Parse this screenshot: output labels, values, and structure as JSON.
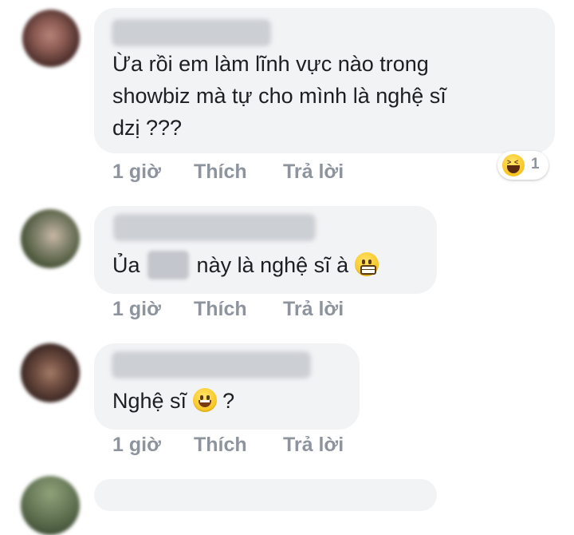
{
  "comments": [
    {
      "text_lines": [
        "Ừa rồi em làm lĩnh vực nào trong",
        "showbiz mà tự cho mình là nghệ sĩ",
        "dzị ???"
      ],
      "time": "1 giờ",
      "like": "Thích",
      "reply": "Trả lời",
      "reaction": {
        "icon": "haha-emoji-icon",
        "count": "1"
      }
    },
    {
      "text_before": "Ủa",
      "text_after": "này là nghệ sĩ à",
      "emoji": "grimacing-emoji-icon",
      "time": "1 giờ",
      "like": "Thích",
      "reply": "Trả lời"
    },
    {
      "text_before": "Nghệ sĩ",
      "text_after": "?",
      "emoji": "grinning-emoji-icon",
      "time": "1 giờ",
      "like": "Thích",
      "reply": "Trả lời"
    }
  ],
  "colors": {
    "bubble": "#f2f3f5",
    "meta_text": "#8d949e",
    "body_text": "#1c1e21"
  }
}
